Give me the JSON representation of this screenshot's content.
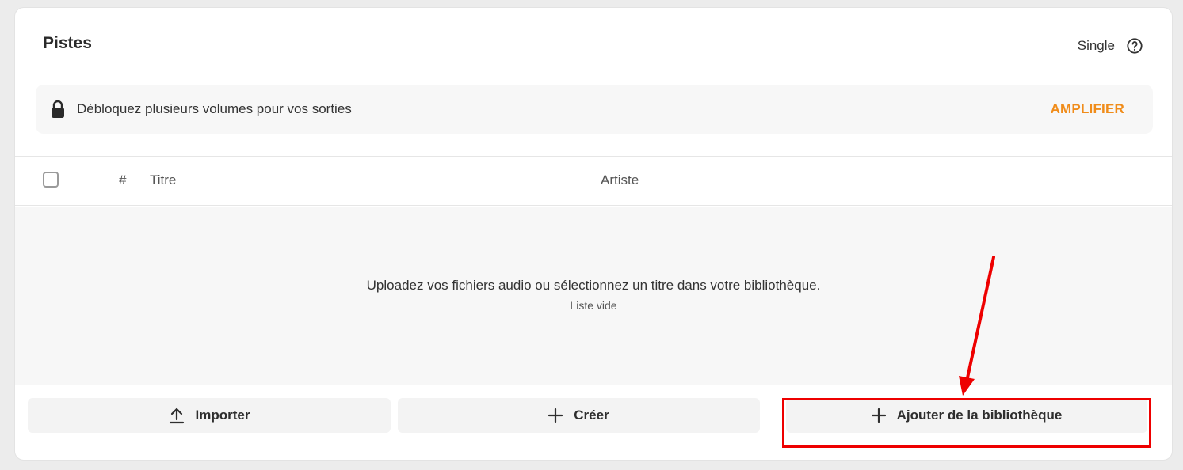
{
  "header": {
    "title": "Pistes",
    "mode": "Single",
    "help_icon": "question-circle-icon"
  },
  "banner": {
    "icon": "lock-icon",
    "text": "Débloquez plusieurs volumes pour vos sorties",
    "action": "AMPLIFIER",
    "action_color": "#f08c1a"
  },
  "table": {
    "columns": [
      "#",
      "Titre",
      "Artiste"
    ]
  },
  "empty_state": {
    "message": "Uploadez vos fichiers audio ou sélectionnez un titre dans votre bibliothèque.",
    "sub": "Liste vide"
  },
  "actions": {
    "import_label": "Importer",
    "import_icon": "upload-icon",
    "create_label": "Créer",
    "create_icon": "plus-icon",
    "library_label": "Ajouter de la bibliothèque",
    "library_icon": "plus-icon"
  },
  "annotation": {
    "color": "#ee0000"
  }
}
